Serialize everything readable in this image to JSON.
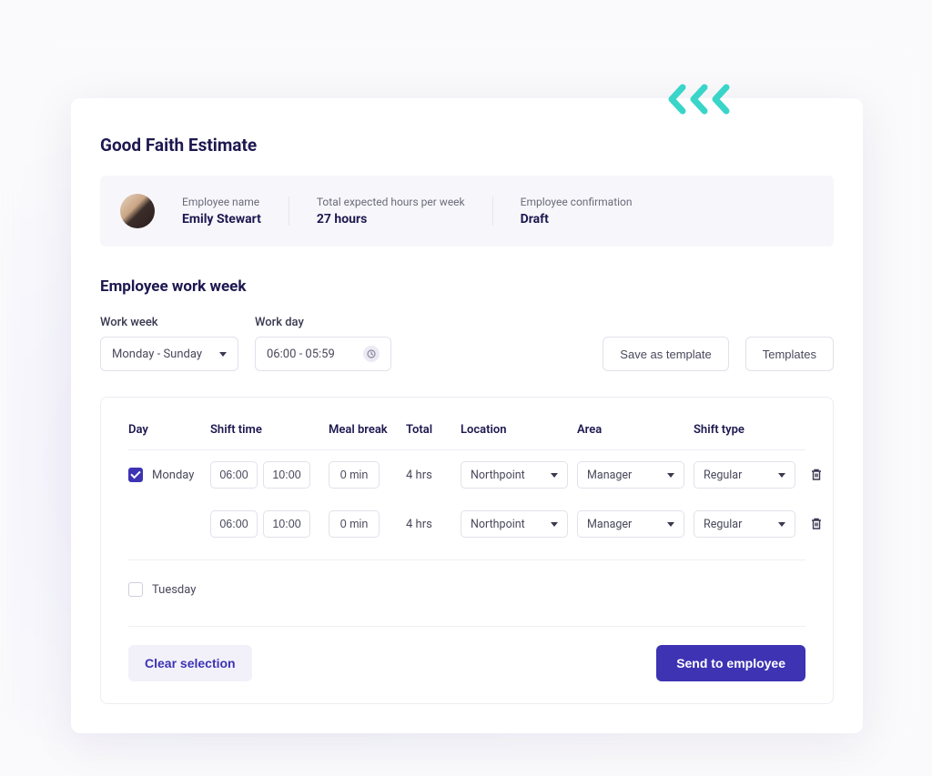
{
  "page_title": "Good Faith Estimate",
  "summary": {
    "employee_name_label": "Employee name",
    "employee_name": "Emily Stewart",
    "hours_label": "Total expected hours per week",
    "hours_value": "27 hours",
    "confirmation_label": "Employee confirmation",
    "confirmation_value": "Draft"
  },
  "section_title": "Employee work week",
  "controls": {
    "work_week_label": "Work week",
    "work_week_value": "Monday - Sunday",
    "work_day_label": "Work day",
    "work_day_value": "06:00 - 05:59",
    "save_template_label": "Save as template",
    "templates_label": "Templates"
  },
  "table": {
    "headers": {
      "day": "Day",
      "shift_time": "Shift time",
      "meal_break": "Meal break",
      "total": "Total",
      "location": "Location",
      "area": "Area",
      "shift_type": "Shift type"
    },
    "days": {
      "monday": "Monday",
      "tuesday": "Tuesday"
    },
    "shifts": [
      {
        "start": "06:00",
        "end": "10:00",
        "meal": "0 min",
        "total": "4 hrs",
        "location": "Northpoint",
        "area": "Manager",
        "type": "Regular"
      },
      {
        "start": "06:00",
        "end": "10:00",
        "meal": "0 min",
        "total": "4 hrs",
        "location": "Northpoint",
        "area": "Manager",
        "type": "Regular"
      }
    ]
  },
  "footer": {
    "clear_label": "Clear selection",
    "send_label": "Send to employee"
  }
}
